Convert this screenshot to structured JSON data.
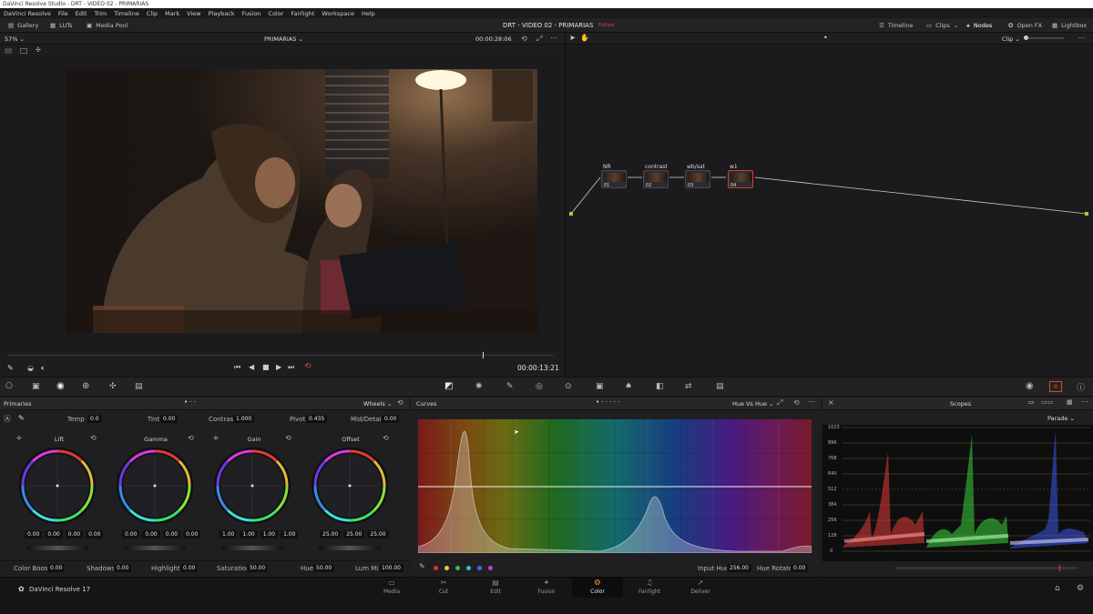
{
  "window": {
    "title": "DaVinci Resolve Studio - DRT - VIDEO 02 - PRIMARIAS"
  },
  "menu": [
    "DaVinci Resolve",
    "File",
    "Edit",
    "Trim",
    "Timeline",
    "Clip",
    "Mark",
    "View",
    "Playback",
    "Fusion",
    "Color",
    "Fairlight",
    "Workspace",
    "Help"
  ],
  "toolbar": {
    "gallery": "Gallery",
    "luts": "LUTs",
    "media_pool": "Media Pool",
    "project_title": "DRT - VIDEO 02 - PRIMARIAS",
    "edited": "Edited",
    "timeline": "Timeline",
    "clips": "Clips",
    "nodes": "Nodes",
    "open_fx": "Open FX",
    "lightbox": "Lightbox"
  },
  "viewer": {
    "zoom": "57%",
    "clip_name": "PRIMARIAS",
    "timecode_top": "00:00:28:06",
    "timecode": "00:00:13:21",
    "playhead_fraction": 0.87
  },
  "nodegraph": {
    "mode": "Clip",
    "nodes": [
      {
        "label": "NR",
        "num": "01"
      },
      {
        "label": "contrast",
        "num": "02"
      },
      {
        "label": "wb/sat",
        "num": "03"
      },
      {
        "label": "w1",
        "num": "04"
      }
    ]
  },
  "primaries": {
    "title": "Primaries",
    "mode": "Wheels",
    "temp_label": "Temp",
    "temp": "0.0",
    "tint_label": "Tint",
    "tint": "0.00",
    "contrast_label": "Contrast",
    "contrast": "1.000",
    "pivot_label": "Pivot",
    "pivot": "0.435",
    "middetail_label": "Mid/Detail",
    "middetail": "0.00",
    "wheels": [
      {
        "name": "Lift",
        "values": [
          "0.00",
          "0.00",
          "0.00",
          "0.00"
        ]
      },
      {
        "name": "Gamma",
        "values": [
          "0.00",
          "0.00",
          "0.00",
          "0.00"
        ]
      },
      {
        "name": "Gain",
        "values": [
          "1.00",
          "1.00",
          "1.00",
          "1.00"
        ]
      },
      {
        "name": "Offset",
        "values": [
          "25.00",
          "25.00",
          "25.00"
        ]
      }
    ],
    "bottom": {
      "color_boost_label": "Color Boost",
      "color_boost": "0.00",
      "shadows_label": "Shadows",
      "shadows": "0.00",
      "highlights_label": "Highlights",
      "highlights": "0.00",
      "saturation_label": "Saturation",
      "saturation": "50.00",
      "hue_label": "Hue",
      "hue": "50.00",
      "lum_mix_label": "Lum Mix",
      "lum_mix": "100.00"
    }
  },
  "curves": {
    "title": "Curves",
    "mode": "Hue Vs Hue",
    "input_hue_label": "Input Hue",
    "input_hue": "256.00",
    "hue_rotate_label": "Hue Rotate",
    "hue_rotate": "0.00",
    "swatch_colors": [
      "#e03434",
      "#e2d233",
      "#33c43a",
      "#33c4c4",
      "#3f6ee8",
      "#d03bd0"
    ]
  },
  "scopes": {
    "title": "Scopes",
    "mode": "Parade",
    "ticks": [
      "1023",
      "896",
      "768",
      "640",
      "512",
      "384",
      "256",
      "128",
      "0"
    ]
  },
  "footer": {
    "brand": "DaVinci Resolve 17",
    "pages": [
      "Media",
      "Cut",
      "Edit",
      "Fusion",
      "Color",
      "Fairlight",
      "Deliver"
    ],
    "active_page": "Color"
  }
}
